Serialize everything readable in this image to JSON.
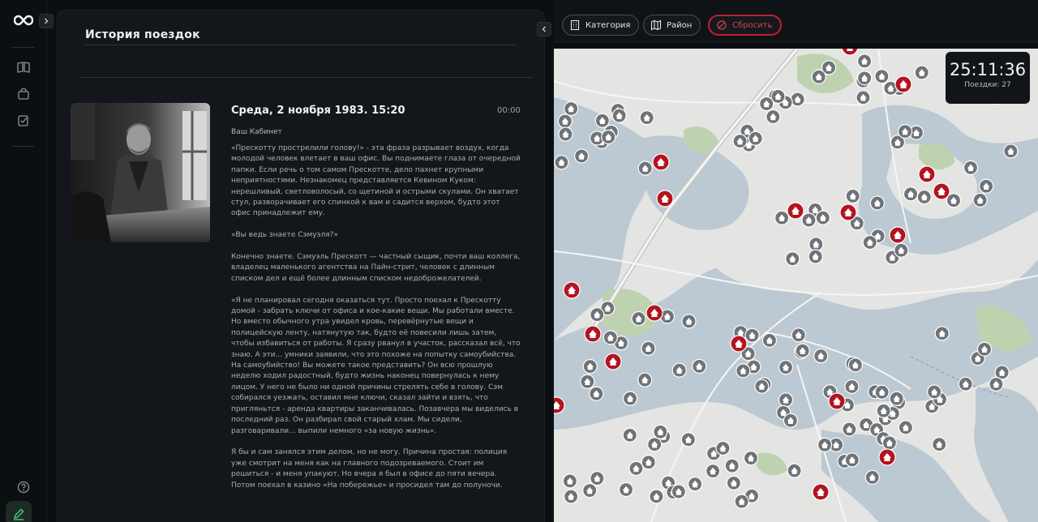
{
  "panel": {
    "title": "История поездок"
  },
  "trip": {
    "date": "Среда, 2 ноября 1983. 15:20",
    "duration": "00:00",
    "location": "Ваш Кабинет",
    "paragraphs": [
      "«Прескотту прострелили голову!» - эта фраза разрывает воздух, когда молодой человек влетает в ваш офис. Вы поднимаете глаза от очередной папки. Если речь о том самом Прескотте, дело пахнет крупными неприятностями. Незнакомец представляется Кевином Куком: нерешливый, светловолосый, со щетиной и острыми скулами. Он хватает стул, разворачивает его спинкой к вам и садится верхом, будто этот офис принадлежит ему.",
      "«Вы ведь знаете Сэмуэля?»",
      "Конечно знаете. Сэмуэль Прескотт — частный сыщик, почти ваш коллега, владелец маленького агентства на Пайн-стрит, человек с длинным списком дел и ещё более длинным списком недоброжелателей.",
      "«Я не планировал сегодня оказаться тут. Просто поехал к Прескотту домой - забрать ключи от офиса и кое-какие вещи. Мы работали вместе. Но вместо обычного утра увидел кровь, перевёрнутые вещи и полицейскую ленту, натянутую так, будто её повесили лишь затем, чтобы избавиться от работы. Я сразу рванул в участок, рассказал всё, что знаю. А эти... умники заявили, что это похоже на попытку самоубийства. На самоубийство! Вы можете такое представить? Он всю прошлую неделю ходил радостный, будто жизнь наконец повернулась к нему лицом. У него не было ни одной причины стрелять себе в голову. Сэм собирался уезжать, оставил мне ключи, сказал зайти и взять, что пригляньтся - аренда квартиры заканчивалась. Позавчера мы виделись в последний раз. Он разбирал свой старый хлам. Мы сидели, разговаривали... выпили немного «за новую жизнь».",
      "Я бы и сам занялся этим делом, но не могу. Причина простая: полиция уже смотрит на меня как на главного подозреваемого. Стоит им решиться - и меня упакуют. Но вчера я был в офисе до пяти вечера. Потом поехал в казино «На побережье» и просидел там до полуночи."
    ]
  },
  "filters": {
    "category": "Категория",
    "district": "Район",
    "reset": "Сбросить"
  },
  "timer": {
    "value": "25:11:36",
    "trips_label": "Поездки: 27"
  },
  "colors": {
    "accent_red": "#b3141f",
    "marker_gray": "#6f7377",
    "water": "#bcc9d3",
    "land": "#e4e5e3",
    "park": "#bfd2b0"
  },
  "icons": {
    "logo": "infinity-logo-icon",
    "expand": "chevron-right-icon",
    "collapse": "chevron-left-icon",
    "nav": [
      "book-icon",
      "bag-icon",
      "checklist-icon"
    ],
    "help": "help-circle-icon",
    "edit": "pencil-icon",
    "category": "building-icon",
    "district": "map-icon",
    "reset": "reset-icon"
  }
}
